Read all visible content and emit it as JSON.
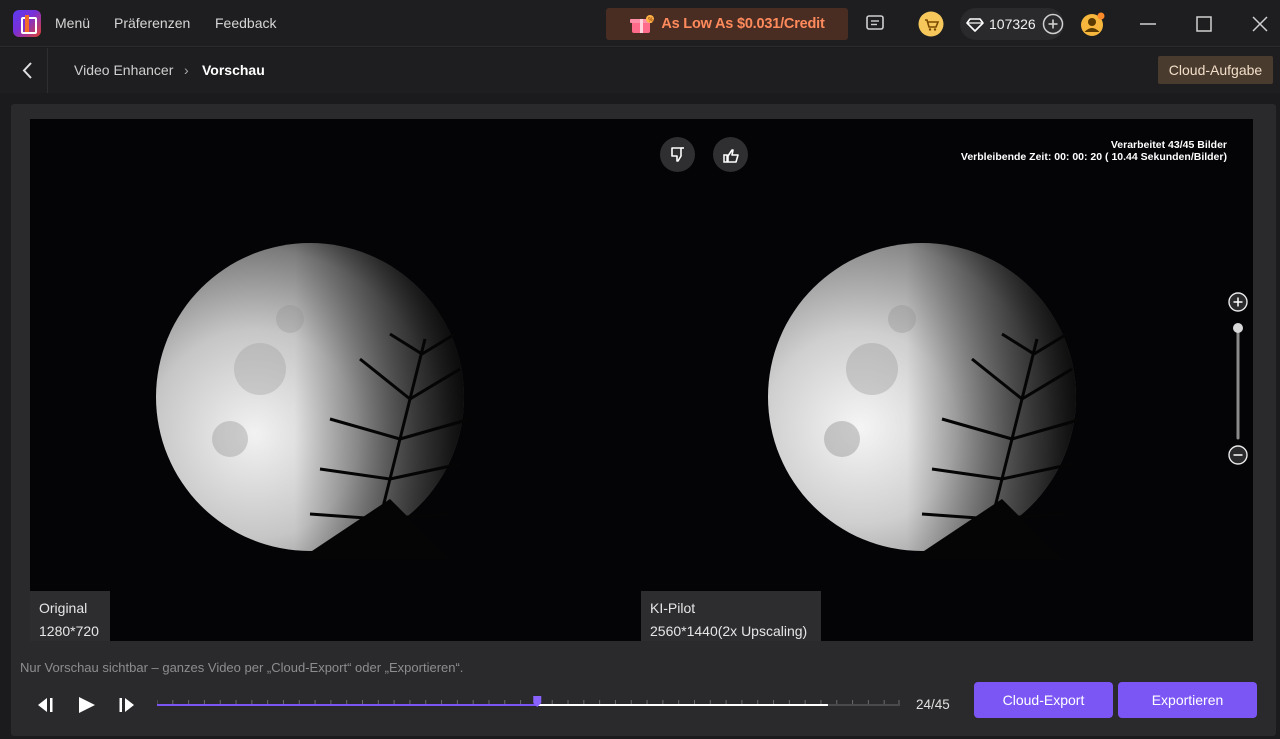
{
  "topbar": {
    "menu_items": [
      "Menü",
      "Präferenzen",
      "Feedback"
    ],
    "promo_text": "As Low As $0.031/Credit",
    "credits": "107326"
  },
  "subbar": {
    "breadcrumb_root": "Video Enhancer",
    "breadcrumb_separator": "›",
    "breadcrumb_current": "Vorschau",
    "cloud_task_label": "Cloud-Aufgabe"
  },
  "viewer": {
    "progress_processed": "Verarbeitet 43/45 Bilder",
    "progress_remaining": "Verbleibende Zeit: 00: 00: 20 ( 10.44 Sekunden/Bilder)",
    "original_label": "Original",
    "original_resolution": "1280*720",
    "ai_label": "KI-Pilot",
    "ai_resolution": "2560*1440(2x Upscaling)",
    "zoom_level": 1.0
  },
  "footer": {
    "hint": "Nur Vorschau sichtbar – ganzes Video per „Cloud-Export“ oder „Exportieren“.",
    "frame_counter": "24/45",
    "current_frame": 24,
    "total_frames": 45,
    "processed_frames": 43,
    "cloud_export_label": "Cloud-Export",
    "export_label": "Exportieren"
  },
  "colors": {
    "accent": "#7b56f5",
    "promo_bg": "#4a2d22",
    "promo_text": "#ff8a5c",
    "cloud_task_bg": "#4a3b2f"
  }
}
